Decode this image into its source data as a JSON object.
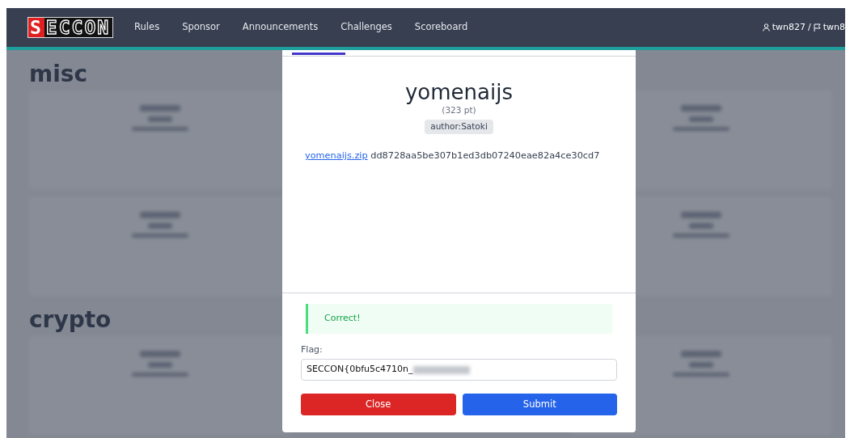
{
  "navbar": {
    "logo": "SECCON",
    "links": [
      {
        "label": "Rules"
      },
      {
        "label": "Sponsor"
      },
      {
        "label": "Announcements"
      },
      {
        "label": "Challenges"
      },
      {
        "label": "Scoreboard"
      }
    ],
    "user": "twn827",
    "separator": "/",
    "team": "twn8"
  },
  "background": {
    "sections": [
      {
        "heading": "misc"
      },
      {
        "heading": "crypto"
      }
    ]
  },
  "modal": {
    "title": "yomenaijs",
    "points": "(323 pt)",
    "author": "author:Satoki",
    "file_link": "yomenaijs.zip",
    "file_hash": "dd8728aa5be307b1ed3db07240eae82a4ce30cd7",
    "alert": {
      "kind": "success",
      "text": "Correct!"
    },
    "flag_label": "Flag:",
    "flag_value": "SECCON{0bfu5c4710n_",
    "flag_redacted": true,
    "buttons": [
      {
        "kind": "close",
        "label": "Close"
      },
      {
        "kind": "submit",
        "label": "Submit"
      }
    ]
  }
}
